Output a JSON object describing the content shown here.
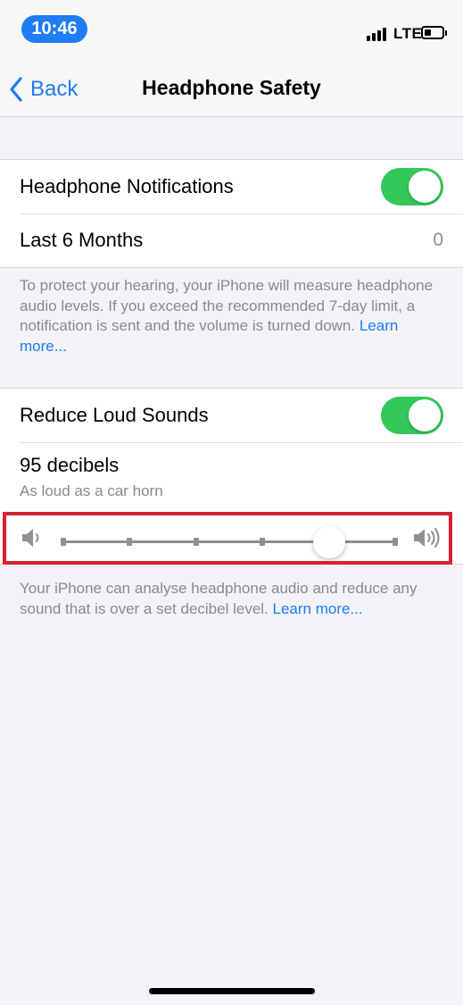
{
  "status_bar": {
    "time": "10:46",
    "network": "LTE"
  },
  "nav": {
    "back_label": "Back",
    "title": "Headphone Safety"
  },
  "group1": {
    "notifications_label": "Headphone Notifications",
    "notifications_on": true,
    "last_months_label": "Last 6 Months",
    "last_months_value": "0"
  },
  "footer1": {
    "text": "To protect your hearing, your iPhone will measure headphone audio levels. If you exceed the recommended 7-day limit, a notification is sent and the volume is turned down. ",
    "link": "Learn more..."
  },
  "group2": {
    "reduce_label": "Reduce Loud Sounds",
    "reduce_on": true,
    "decibels_label": "95 decibels",
    "decibels_sub": "As loud as a car horn",
    "slider_value_fraction": 0.8,
    "slider_steps": 5
  },
  "footer2": {
    "text": "Your iPhone can analyse headphone audio and reduce any sound that is over a set decibel level. ",
    "link": "Learn more..."
  },
  "colors": {
    "accent": "#1e7cf4",
    "toggle_on": "#34c759",
    "highlight": "#d8202f"
  },
  "icons": [
    "back-chevron-icon",
    "signal-icon",
    "battery-icon",
    "volume-low-icon",
    "volume-high-icon"
  ]
}
